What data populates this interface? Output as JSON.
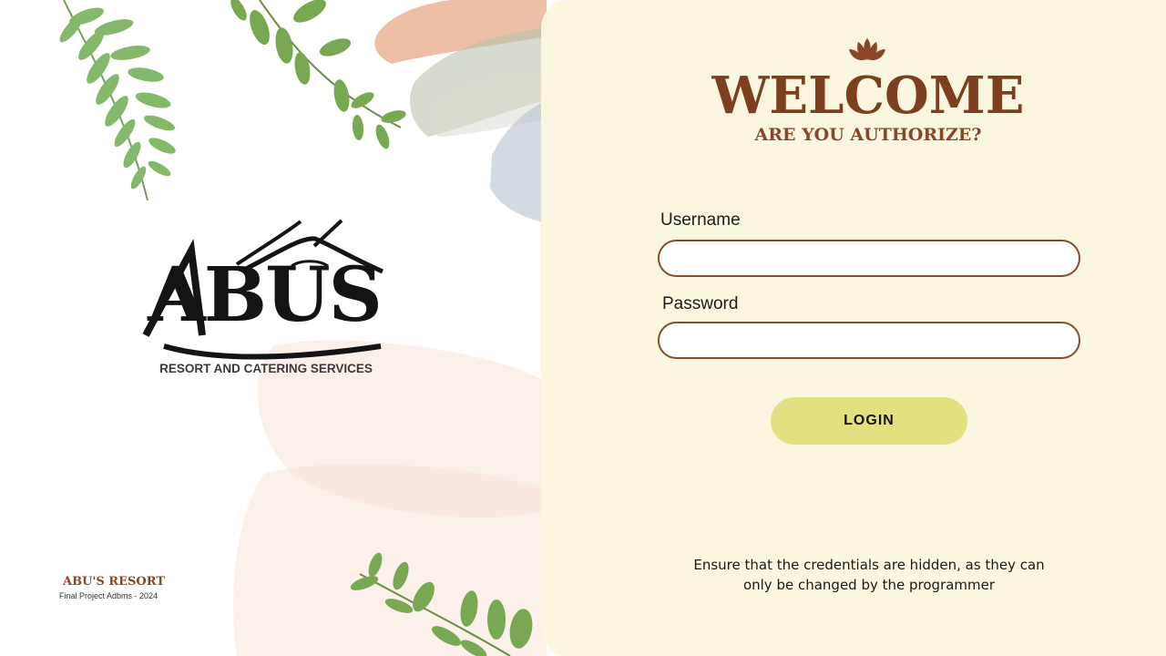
{
  "brand": {
    "logo_text": "ABUS",
    "logo_subtitle": "RESORT AND CATERING SERVICES",
    "footer_title": "ABU'S RESORT",
    "footer_subtitle": "Final Project Adbms - 2024"
  },
  "login": {
    "heading": "WELCOME",
    "subheading": "ARE YOU AUTHORIZE?",
    "username_label": "Username",
    "username_value": "",
    "password_label": "Password",
    "password_value": "",
    "login_button": "LOGIN",
    "note": "Ensure that the credentials are hidden, as they can only be changed by the programmer"
  },
  "icons": {
    "lotus": "lotus-icon",
    "leaves": "leaf-icon"
  },
  "colors": {
    "panel_bg": "#faf6df",
    "accent_brown": "#7d3f1f",
    "button_yellow": "#e3e07f",
    "input_border": "#8a4a2c"
  }
}
